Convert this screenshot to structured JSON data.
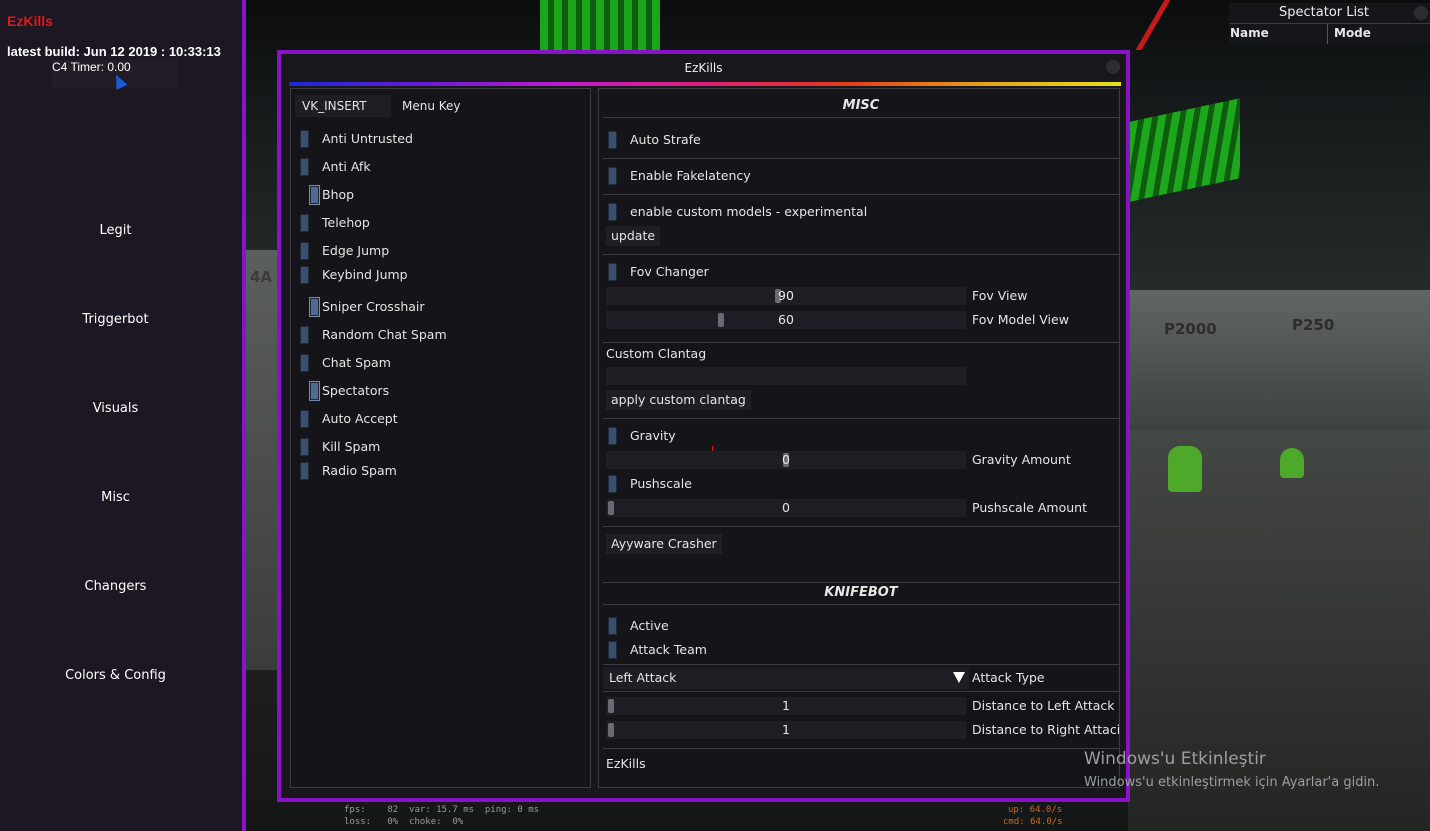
{
  "sidebar": {
    "brand": "EzKills",
    "build": "latest build: Jun 12 2019 : 10:33:13",
    "c4_timer": "C4 Timer: 0.00",
    "nav": [
      "Legit",
      "Triggerbot",
      "Visuals",
      "Misc",
      "Changers",
      "Colors & Config"
    ]
  },
  "spectator_list": {
    "title": "Spectator List",
    "col_name": "Name",
    "col_mode": "Mode"
  },
  "window": {
    "title": "EzKills",
    "accent": "#8a13c9"
  },
  "left_panel": {
    "menu_key_value": "VK_INSERT",
    "menu_key_label": "Menu Key",
    "toggles": [
      {
        "label": "Anti Untrusted",
        "on": false
      },
      {
        "label": "Anti Afk",
        "on": false
      },
      {
        "label": "Bhop",
        "on": true
      },
      {
        "label": "Telehop",
        "on": false
      },
      {
        "label": "Edge Jump",
        "on": false
      },
      {
        "label": "Keybind Jump",
        "on": false
      },
      {
        "label": "Sniper Crosshair",
        "on": true
      },
      {
        "label": "Random Chat Spam",
        "on": false
      },
      {
        "label": "Chat Spam",
        "on": false
      },
      {
        "label": "Spectators",
        "on": true
      },
      {
        "label": "Auto Accept",
        "on": false
      },
      {
        "label": "Kill Spam",
        "on": false
      },
      {
        "label": "Radio Spam",
        "on": false
      }
    ]
  },
  "misc": {
    "title": "MISC",
    "auto_strafe": "Auto Strafe",
    "enable_fakelatency": "Enable Fakelatency",
    "custom_models": "enable custom models - experimental",
    "update_button": "update",
    "fov_changer": "Fov Changer",
    "fov_view_value": "90",
    "fov_view_label": "Fov View",
    "fov_model_value": "60",
    "fov_model_label": "Fov Model View",
    "custom_clantag": "Custom Clantag",
    "clantag_value": "",
    "apply_clantag": "apply custom clantag",
    "gravity": "Gravity",
    "gravity_value": "0",
    "gravity_label": "Gravity Amount",
    "pushscale": "Pushscale",
    "pushscale_value": "0",
    "pushscale_label": "Pushscale Amount",
    "ayyware_crasher": "Ayyware Crasher"
  },
  "knifebot": {
    "title": "KNIFEBOT",
    "active": "Active",
    "attack_team": "Attack Team",
    "attack_type_value": "Left Attack",
    "attack_type_label": "Attack Type",
    "dist_left_value": "1",
    "dist_left_label": "Distance to Left Attack",
    "dist_right_value": "1",
    "dist_right_label": "Distance to Right Attaci",
    "footer": "EzKills"
  },
  "watermark": {
    "line1": "Windows'u Etkinleştir",
    "line2": "Windows'u etkinleştirmek için Ayarlar'a gidin."
  },
  "netgraph": {
    "left1": "fps:    82  var: 15.7 ms  ping: 0 ms",
    "left2": "loss:   0%  choke:  0%",
    "right1": "up: 64.0/s",
    "right2": "cmd: 64.0/s"
  },
  "map_labels": [
    "P2000",
    "P250",
    "4A"
  ]
}
